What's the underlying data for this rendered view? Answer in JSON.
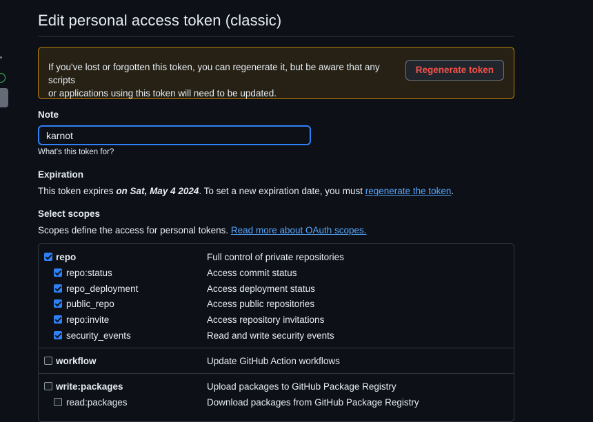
{
  "page": {
    "title": "Edit personal access token (classic)"
  },
  "warning": {
    "line1": "If you've lost or forgotten this token, you can regenerate it, but be aware that any scripts",
    "line2": "or applications using this token will need to be updated.",
    "button_label": "Regenerate token"
  },
  "note": {
    "label": "Note",
    "value": "karnot",
    "hint": "What's this token for?"
  },
  "expiration": {
    "label": "Expiration",
    "text_before": "This token expires ",
    "date": "on Sat, May 4 2024",
    "text_after": ". To set a new expiration date, you must ",
    "link": "regenerate the token",
    "text_end": "."
  },
  "scopes": {
    "label": "Select scopes",
    "text": "Scopes define the access for personal tokens. ",
    "link": "Read more about OAuth scopes.",
    "groups": [
      {
        "name": "repo",
        "desc": "Full control of private repositories",
        "checked": true,
        "children": [
          {
            "name": "repo:status",
            "desc": "Access commit status",
            "checked": true
          },
          {
            "name": "repo_deployment",
            "desc": "Access deployment status",
            "checked": true
          },
          {
            "name": "public_repo",
            "desc": "Access public repositories",
            "checked": true
          },
          {
            "name": "repo:invite",
            "desc": "Access repository invitations",
            "checked": true
          },
          {
            "name": "security_events",
            "desc": "Read and write security events",
            "checked": true
          }
        ]
      },
      {
        "name": "workflow",
        "desc": "Update GitHub Action workflows",
        "checked": false,
        "children": []
      },
      {
        "name": "write:packages",
        "desc": "Upload packages to GitHub Package Registry",
        "checked": false,
        "children": [
          {
            "name": "read:packages",
            "desc": "Download packages from GitHub Package Registry",
            "checked": false
          }
        ]
      }
    ]
  },
  "colors": {
    "accent": "#2f81f7",
    "danger": "#f85149",
    "link": "#58a6ff",
    "warning_border": "#bb8009"
  }
}
